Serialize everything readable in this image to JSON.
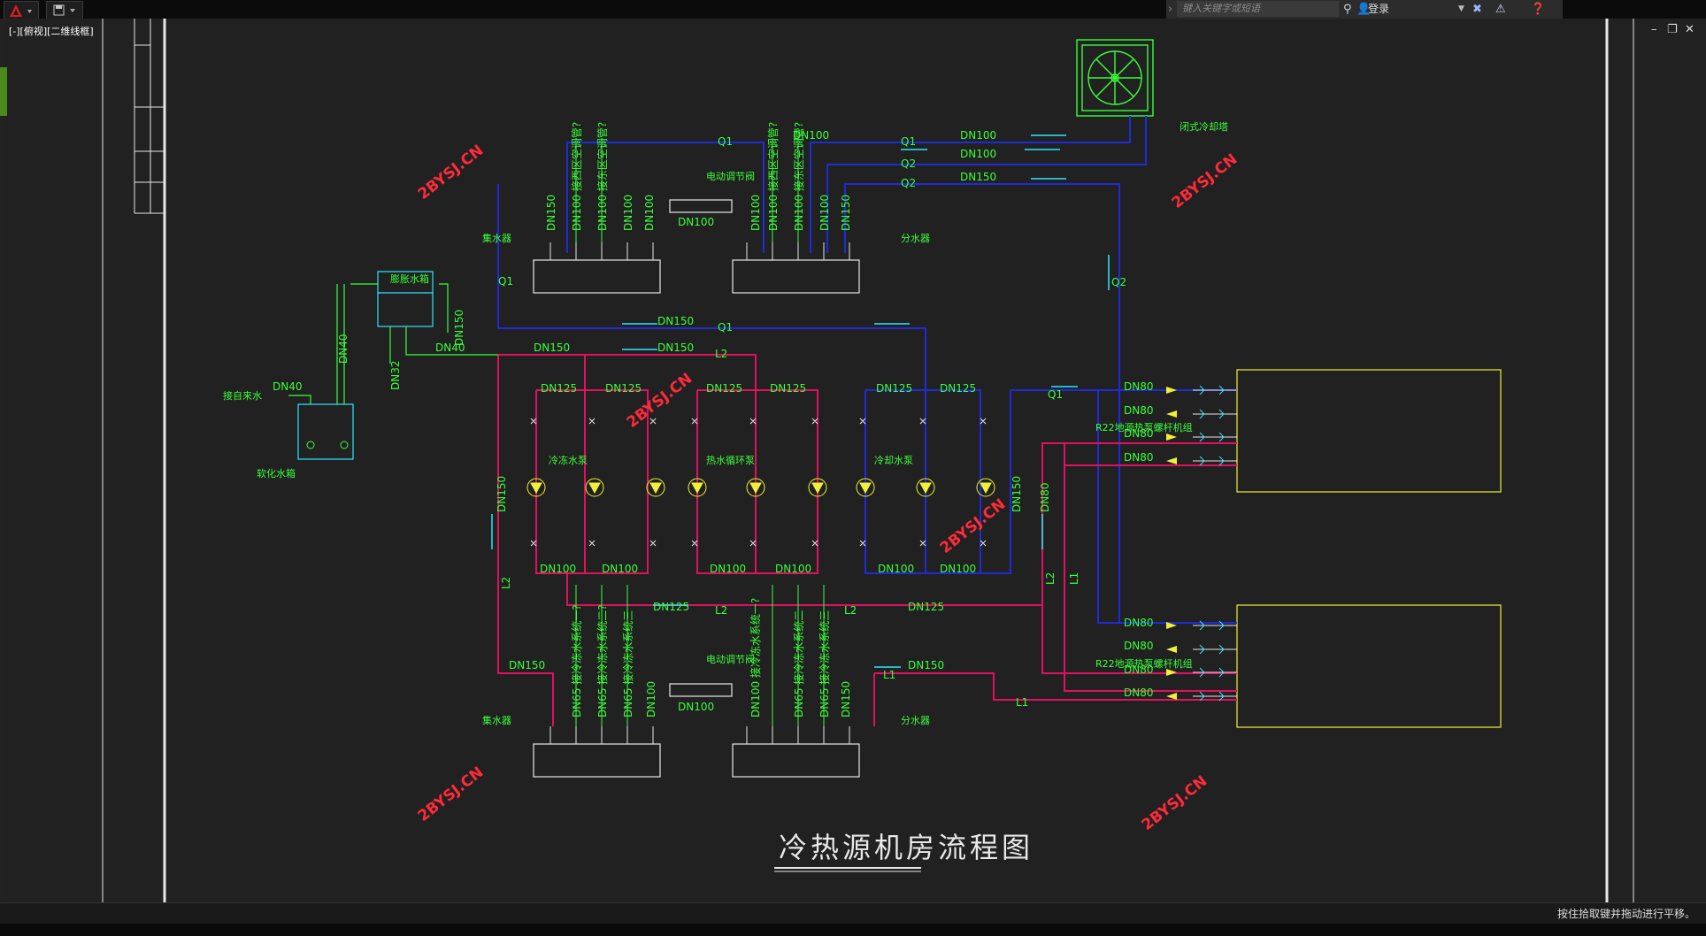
{
  "toolbar": {
    "search_placeholder": "键入关键字或短语",
    "login_label": "登录",
    "tab_label": "[-][俯视][二维线框]"
  },
  "status": {
    "hint": "按住拾取键并拖动进行平移。"
  },
  "drawing": {
    "title": "冷热源机房流程图",
    "watermark": "2BYSJ.CN",
    "units": {
      "unit1": "R22地源热泵螺杆机组",
      "unit2": "R22地源热泵螺杆机组"
    },
    "equipment": {
      "expansion_tank": "膨胀水箱",
      "softened_tank": "软化水箱",
      "cooling_tower": "闭式冷却塔",
      "collector_top": "集水器",
      "distributor_top": "分水器",
      "collector_bottom": "集水器",
      "distributor_bottom": "分水器",
      "valve_top": "电动调节阀",
      "valve_bottom": "电动调节阀",
      "pump_group_1": "冷冻水泵",
      "pump_group_2": "热水循环泵",
      "pump_group_3": "冷却水泵",
      "makeup_water": "接自来水",
      "dn100_valve_top": "DN100",
      "dn100_valve_bottom": "DN100"
    },
    "pipe_labels": {
      "dn150": "DN150",
      "dn125": "DN125",
      "dn100": "DN100",
      "dn80": "DN80",
      "dn65": "DN65",
      "dn40": "DN40",
      "dn32": "DN32",
      "q1": "Q1",
      "q2": "Q2",
      "l1": "L1",
      "l2": "L2"
    },
    "vertical_labels": {
      "top_left_a": "DN150",
      "top_left_b": "DN100 接西区空调管?",
      "top_left_c": "DN100 接东区空调管?",
      "top_left_d": "DN100",
      "top_left_e": "DN100",
      "top_right_a": "DN100",
      "top_right_b": "DN100 接西区空调管?",
      "top_right_c": "DN100 接东区空调管?",
      "top_right_d": "DN100",
      "top_right_e": "DN150",
      "bot_left_a": "DN65 接冷冻水系统一?",
      "bot_left_b": "DN65 接冷冻水系统二?",
      "bot_left_c": "DN65 接冷冻水系统三",
      "bot_left_d": "DN100",
      "bot_right_a": "DN100 接冷冻水系统一?",
      "bot_right_b": "DN65 接冷冻水系统二",
      "bot_right_c": "DN65 接冷冻水系统三",
      "bot_right_d": "DN150"
    },
    "colors": {
      "green": "#3bff3b",
      "blue": "#1f2bd6",
      "magenta": "#e0115f",
      "yellow": "#f0f03a",
      "white": "#e8e8e8",
      "cyan": "#2ee6ff",
      "red_watermark": "#ff2a3a"
    }
  }
}
